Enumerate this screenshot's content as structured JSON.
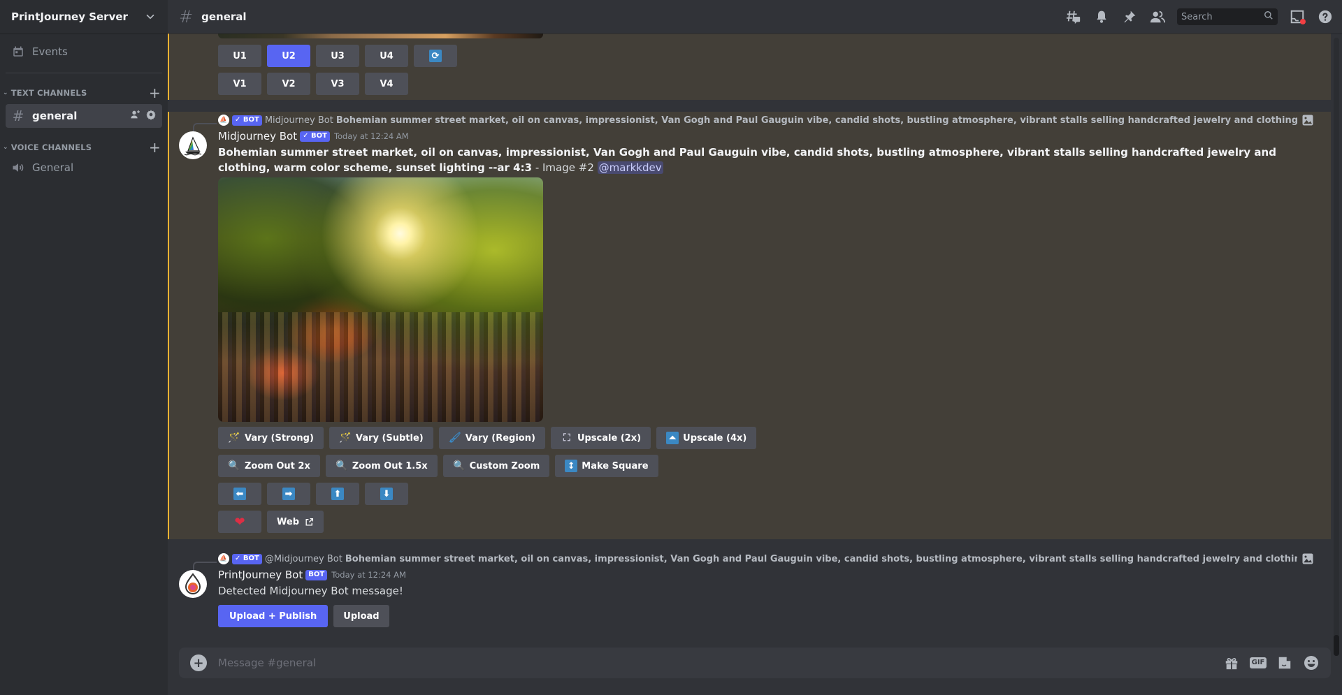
{
  "server": {
    "name": "PrintJourney Server"
  },
  "sidebar": {
    "events_label": "Events",
    "text_category": "TEXT CHANNELS",
    "voice_category": "VOICE CHANNELS",
    "text_channels": [
      {
        "name": "general",
        "active": true
      }
    ],
    "voice_channels": [
      {
        "name": "General"
      }
    ]
  },
  "header": {
    "channel_name": "general",
    "search_placeholder": "Search"
  },
  "previous_message": {
    "upscale_buttons": [
      "U1",
      "U2",
      "U3",
      "U4"
    ],
    "selected_upscale": "U2",
    "variation_buttons": [
      "V1",
      "V2",
      "V3",
      "V4"
    ],
    "reroll_icon": "refresh-icon"
  },
  "midjourney_message": {
    "reply": {
      "tag": "✓ BOT",
      "author": "Midjourney Bot",
      "text": "Bohemian summer street market, oil on canvas, impressionist, Van Gogh and Paul Gauguin vibe, candid shots, bustling atmosphere, vibrant stalls selling handcrafted jewelry and clothing, warm color scheme, sunset lighting"
    },
    "author": "Midjourney Bot",
    "tag": "✓ BOT",
    "timestamp": "Today at 12:24 AM",
    "prompt": "Bohemian summer street market, oil on canvas, impressionist, Van Gogh and Paul Gauguin vibe, candid shots, bustling atmosphere, vibrant stalls selling handcrafted jewelry and clothing, warm color scheme, sunset lighting --ar 4:3",
    "suffix": " - Image #2 ",
    "mention": "@markkdev",
    "image_alt": "Impressionist painting of a bustling street market under trees at sunset with orange umbrellas",
    "row1": [
      {
        "icon": "magic-wand-icon",
        "glyph": "🪄",
        "label": "Vary (Strong)"
      },
      {
        "icon": "magic-wand-icon",
        "glyph": "🪄",
        "label": "Vary (Subtle)"
      },
      {
        "icon": "paintbrush-icon",
        "glyph": "🖌",
        "label": "Vary (Region)"
      },
      {
        "icon": "expand-icon",
        "glyph": "⛶",
        "label": "Upscale (2x)"
      },
      {
        "icon": "double-up-arrow-icon",
        "glyph": "⏫",
        "label": "Upscale (4x)"
      }
    ],
    "row2": [
      {
        "icon": "magnifier-icon",
        "glyph": "🔍",
        "label": "Zoom Out 2x"
      },
      {
        "icon": "magnifier-icon",
        "glyph": "🔍",
        "label": "Zoom Out 1.5x"
      },
      {
        "icon": "magnifier-icon",
        "glyph": "🔍",
        "label": "Custom Zoom"
      },
      {
        "icon": "up-down-arrow-icon",
        "glyph": "↕",
        "label": "Make Square"
      }
    ],
    "pan_buttons": [
      {
        "icon": "arrow-left-icon",
        "glyph": "⬅"
      },
      {
        "icon": "arrow-right-icon",
        "glyph": "➡"
      },
      {
        "icon": "arrow-up-icon",
        "glyph": "⬆"
      },
      {
        "icon": "arrow-down-icon",
        "glyph": "⬇"
      }
    ],
    "favorite_glyph": "❤",
    "web_label": "Web"
  },
  "printjourney_message": {
    "reply": {
      "tag": "✓ BOT",
      "author": "@Midjourney Bot",
      "text": "Bohemian summer street market, oil on canvas, impressionist, Van Gogh and Paul Gauguin vibe, candid shots, bustling atmosphere, vibrant stalls selling handcrafted jewelry and clothing, warm color scheme, sunset lighting"
    },
    "author": "PrintJourney Bot",
    "tag": "BOT",
    "timestamp": "Today at 12:24 AM",
    "content": "Detected Midjourney Bot message!",
    "buttons": [
      "Upload + Publish",
      "Upload"
    ]
  },
  "composer": {
    "placeholder": "Message #general",
    "gif_label": "GIF"
  },
  "colors": {
    "accent": "#5865f2",
    "highlight_bg": "#433f38",
    "highlight_border": "#f0b232",
    "notification_dot": "#f23f43"
  }
}
